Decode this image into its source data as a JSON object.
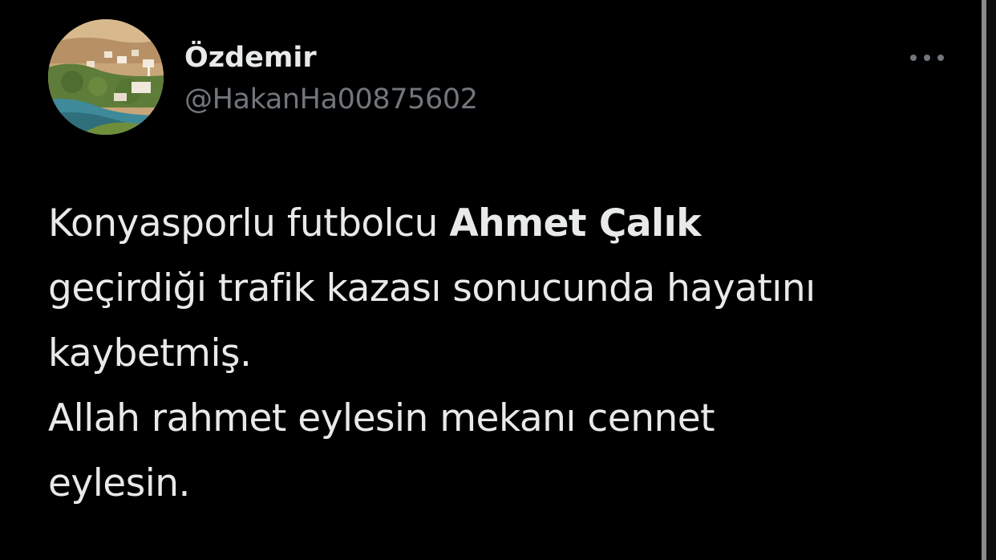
{
  "user": {
    "display_name": "Özdemir",
    "handle": "@HakanHa00875602",
    "avatar_icon": "avatar-landscape-photo"
  },
  "menu": {
    "more_icon": "more-horizontal-icon"
  },
  "tweet": {
    "line1_pre": "Konyasporlu futbolcu ",
    "line1_bold": "Ahmet Çalık",
    "line2": "geçirdiği trafik kazası sonucunda hayatını",
    "line3": "kaybetmiş.",
    "line4": "Allah rahmet eylesin mekanı cennet",
    "line5": "eylesin."
  },
  "colors": {
    "background": "#000000",
    "primary_text": "#e7e9ea",
    "secondary_text": "#71767b"
  }
}
